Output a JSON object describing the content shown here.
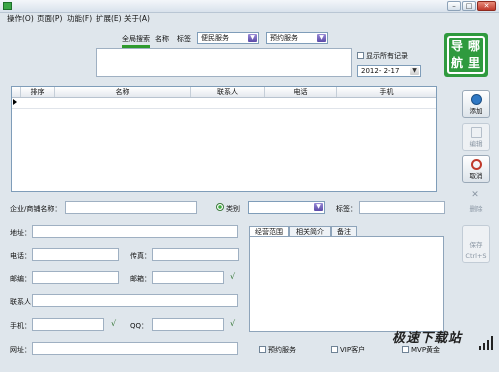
{
  "menu": [
    "操作(O)",
    "页面(P)",
    "功能(F)",
    "扩展(E)",
    "关于(A)"
  ],
  "search": {
    "tabs": [
      "全局搜索",
      "名称",
      "标签"
    ],
    "service_type": "便民服务",
    "appointment": "预约服务",
    "show_all_label": "显示所有记录",
    "date": "2012- 2-17"
  },
  "logo_chars": [
    "导",
    "哪",
    "航",
    "里"
  ],
  "table": {
    "columns": [
      "排序",
      "名称",
      "联系人",
      "电话",
      "手机"
    ]
  },
  "sidebar": {
    "add": "添加",
    "edit": "编辑",
    "cancel": "取消",
    "delete": "删除",
    "save": "保存",
    "save_shortcut": "Ctrl+S"
  },
  "form": {
    "company_label": "企业/商铺名称：",
    "category_label": "类别",
    "tag_label": "标签：",
    "address_label": "地址：",
    "phone_label": "电话：",
    "fax_label": "传真：",
    "postcode_label": "邮编：",
    "email_label": "邮箱：",
    "contact_label": "联系人",
    "mobile_label": "手机：",
    "qq_label": "QQ：",
    "website_label": "网址：",
    "checkmark": "√"
  },
  "panel_tabs": [
    "经营范围",
    "相关简介",
    "备注"
  ],
  "bottom_checks": [
    "预约服务",
    "VIP客户",
    "MVP黄金"
  ],
  "watermark": "极速下载站",
  "colors": {
    "accent_green": "#2f9a3e",
    "select_button": "#5b4aa8"
  }
}
